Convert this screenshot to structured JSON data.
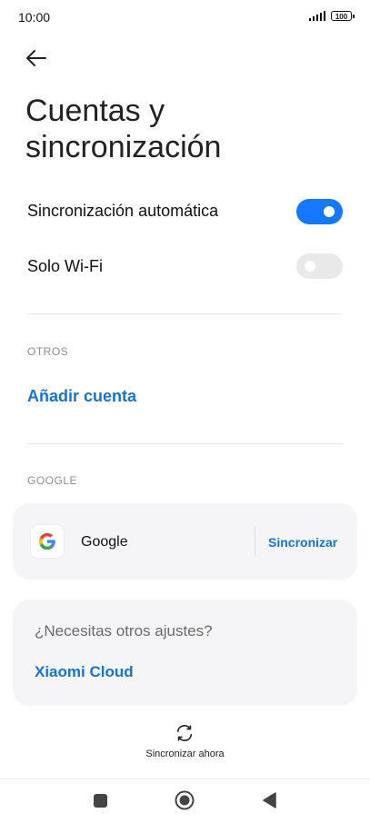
{
  "status_bar": {
    "time": "10:00",
    "battery": "100"
  },
  "page": {
    "title": "Cuentas y sincronización"
  },
  "settings": [
    {
      "label": "Sincronización automática",
      "state": "on"
    },
    {
      "label": "Solo Wi-Fi",
      "state": "off"
    }
  ],
  "sections": {
    "otros": "OTROS",
    "add_account": "Añadir cuenta",
    "google": "GOOGLE"
  },
  "google_account": {
    "name": "Google",
    "action": "Sincronizar"
  },
  "more_settings": {
    "question": "¿Necesitas otros ajustes?",
    "link": "Xiaomi Cloud"
  },
  "sync_now": {
    "label": "Sincronizar ahora"
  },
  "colors": {
    "accent": "#1677ff",
    "link": "#1574d4"
  }
}
